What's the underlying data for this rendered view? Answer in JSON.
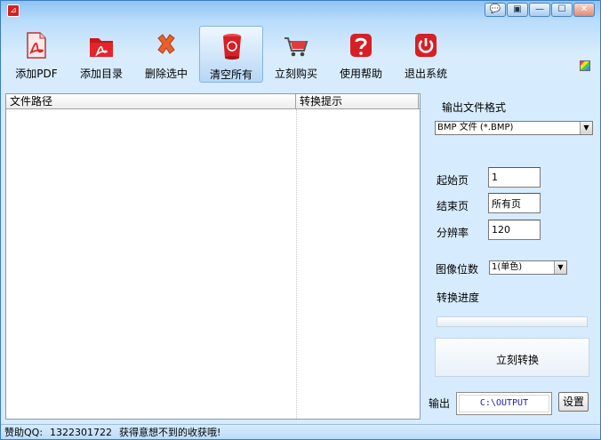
{
  "titlebar": {
    "controls": [
      {
        "name": "chat",
        "glyph": "💬"
      },
      {
        "name": "skin",
        "glyph": "▣"
      },
      {
        "name": "minimize",
        "glyph": "—"
      },
      {
        "name": "maximize",
        "glyph": "☐"
      },
      {
        "name": "close",
        "glyph": "✕"
      }
    ]
  },
  "toolbar": {
    "items": [
      {
        "label": "添加PDF",
        "icon": "pdf-file-icon"
      },
      {
        "label": "添加目录",
        "icon": "folder-icon"
      },
      {
        "label": "删除选中",
        "icon": "delete-x-icon"
      },
      {
        "label": "清空所有",
        "icon": "trash-bin-icon"
      },
      {
        "label": "立刻购买",
        "icon": "shopping-cart-icon"
      },
      {
        "label": "使用帮助",
        "icon": "help-icon"
      },
      {
        "label": "退出系统",
        "icon": "power-icon"
      }
    ],
    "active_index": 3
  },
  "file_list": {
    "columns": [
      "文件路径",
      "转换提示"
    ],
    "rows": []
  },
  "settings": {
    "format_label": "输出文件格式",
    "format_value": "BMP 文件 (*.BMP)",
    "start_page_label": "起始页",
    "start_page_value": "1",
    "end_page_label": "结束页",
    "end_page_value": "所有页",
    "resolution_label": "分辨率",
    "resolution_value": "120",
    "bit_depth_label": "图像位数",
    "bit_depth_value": "1(单色)",
    "progress_label": "转换进度",
    "progress_value": 0,
    "convert_button": "立刻转换",
    "output_label": "输出",
    "output_path": "C:\\OUTPUT",
    "settings_button": "设置"
  },
  "status": {
    "qq_label": "赞助QQ:",
    "qq_number": "1322301722",
    "message": "获得意想不到的收获哦!"
  },
  "colors": {
    "accent": "#3b7cc2",
    "pdf_red": "#d81e1e",
    "output_text": "#1a1ab0"
  }
}
